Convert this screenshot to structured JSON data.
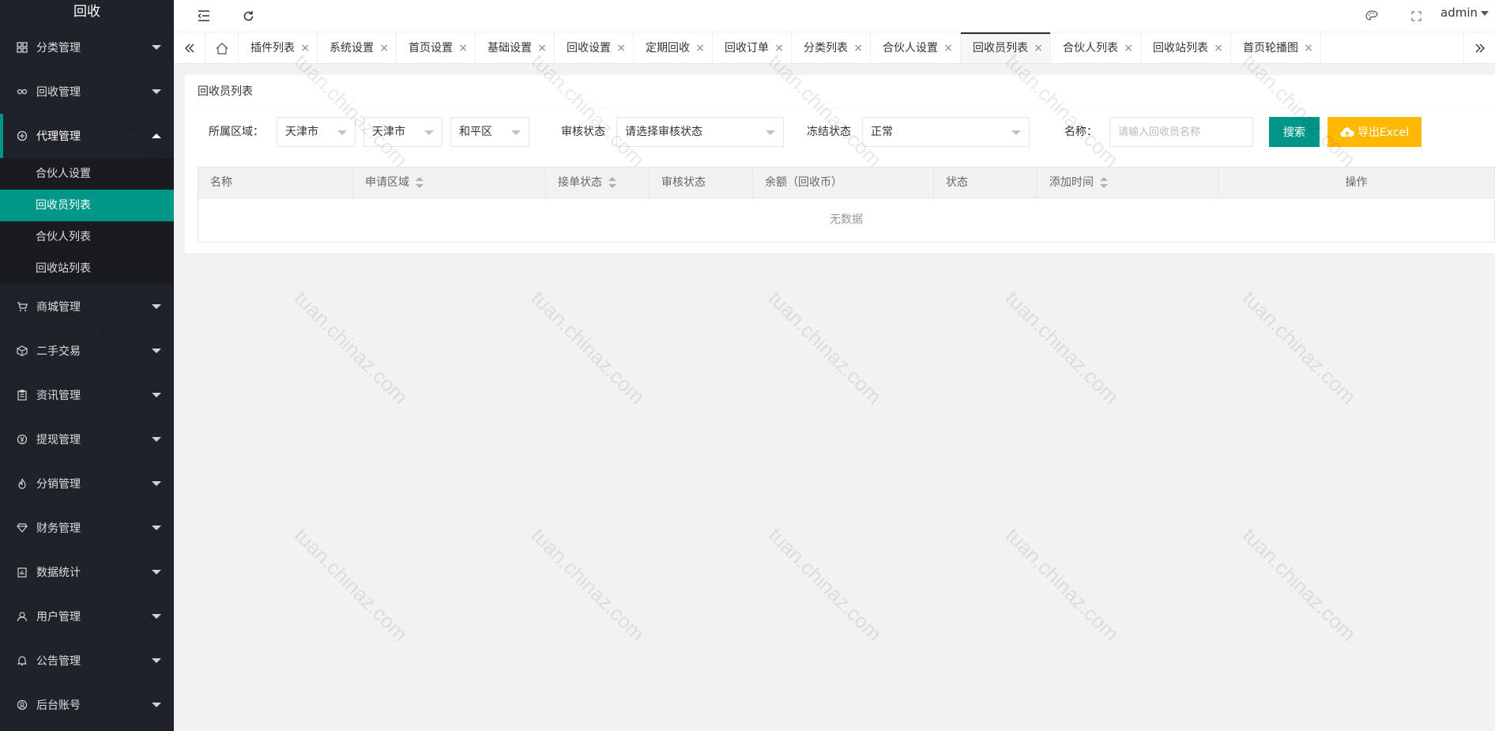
{
  "sidebar": {
    "logo": "回收",
    "menus": [
      {
        "label": "分类管理",
        "icon": "category-icon"
      },
      {
        "label": "回收管理",
        "icon": "link-icon"
      },
      {
        "label": "代理管理",
        "icon": "agent-icon",
        "open": true,
        "children": [
          "合伙人设置",
          "回收员列表",
          "合伙人列表",
          "回收站列表"
        ],
        "active_child": "回收员列表"
      },
      {
        "label": "商城管理",
        "icon": "cart-icon"
      },
      {
        "label": "二手交易",
        "icon": "box-icon"
      },
      {
        "label": "资讯管理",
        "icon": "clipboard-icon"
      },
      {
        "label": "提现管理",
        "icon": "yen-icon"
      },
      {
        "label": "分销管理",
        "icon": "fire-icon"
      },
      {
        "label": "财务管理",
        "icon": "diamond-icon"
      },
      {
        "label": "数据统计",
        "icon": "chart-icon"
      },
      {
        "label": "用户管理",
        "icon": "user-icon"
      },
      {
        "label": "公告管理",
        "icon": "bell-icon"
      },
      {
        "label": "后台账号",
        "icon": "account-icon"
      }
    ]
  },
  "header": {
    "user": "admin"
  },
  "tabs": [
    {
      "label": "插件列表"
    },
    {
      "label": "系统设置"
    },
    {
      "label": "首页设置"
    },
    {
      "label": "基础设置"
    },
    {
      "label": "回收设置"
    },
    {
      "label": "定期回收"
    },
    {
      "label": "回收订单"
    },
    {
      "label": "分类列表"
    },
    {
      "label": "合伙人设置"
    },
    {
      "label": "回收员列表",
      "active": true
    },
    {
      "label": "合伙人列表"
    },
    {
      "label": "回收站列表"
    },
    {
      "label": "首页轮播图"
    }
  ],
  "tab_close": "×",
  "card": {
    "title": "回收员列表",
    "filters": {
      "region_label": "所属区域：",
      "province": "天津市",
      "city": "天津市",
      "district": "和平区",
      "audit_label": "审核状态",
      "audit_value": "请选择审核状态",
      "freeze_label": "冻结状态",
      "freeze_value": "正常",
      "name_label": "名称：",
      "name_placeholder": "请输入回收员名称",
      "search_btn": "搜索",
      "export_btn": "导出Excel"
    },
    "table": {
      "columns": [
        "名称",
        "申请区域",
        "接单状态",
        "审核状态",
        "余额（回收币）",
        "状态",
        "添加时间",
        "操作"
      ],
      "empty_text": "无数据"
    }
  },
  "watermark": "tuan.chinaz.com",
  "colors": {
    "sidebar_bg": "#20222a",
    "accent": "#009688",
    "warning": "#ffb800"
  }
}
